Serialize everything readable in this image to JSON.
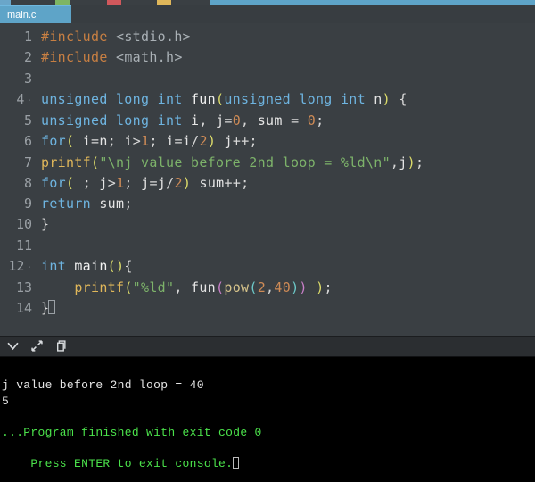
{
  "headerbar_colors": [
    "#6aa6c9",
    "#3a3f43",
    "#7eb563",
    "#3a3f43",
    "#d1585c",
    "#3a3f43",
    "#e0b75a",
    "#3a3f43",
    "#5ea4c8"
  ],
  "headerbar_widths": [
    12,
    50,
    16,
    42,
    16,
    40,
    16,
    44,
    364
  ],
  "tab": {
    "label": "main.c"
  },
  "code_lines": {
    "1": {
      "n": "1",
      "html": "<span class='tok-pp'>#include</span> <span class='tok-header'>&lt;stdio.h&gt;</span>"
    },
    "2": {
      "n": "2",
      "html": "<span class='tok-pp'>#include</span> <span class='tok-header'>&lt;math.h&gt;</span>"
    },
    "3": {
      "n": "3",
      "html": ""
    },
    "4": {
      "n": "4",
      "fold": true,
      "html": "<span class='tok-type'>unsigned long int</span> <span class='tok-func'>fun</span><span class='tok-paren-y'>(</span><span class='tok-type'>unsigned long int</span> <span class='tok-ident'>n</span><span class='tok-paren-y'>)</span> <span class='tok-brace'>{</span>"
    },
    "5": {
      "n": "5",
      "html": "<span class='tok-type'>unsigned long int</span> <span class='tok-ident'>i</span><span class='tok-punct'>,</span> <span class='tok-ident'>j</span><span class='tok-op'>=</span><span class='tok-num'>0</span><span class='tok-punct'>,</span> <span class='tok-ident'>sum</span> <span class='tok-op'>=</span> <span class='tok-num'>0</span><span class='tok-punct'>;</span>"
    },
    "6": {
      "n": "6",
      "html": "<span class='tok-kw'>for</span><span class='tok-paren-y'>(</span> <span class='tok-ident'>i</span><span class='tok-op'>=</span><span class='tok-ident'>n</span><span class='tok-punct'>;</span> <span class='tok-ident'>i</span><span class='tok-op'>&gt;</span><span class='tok-num'>1</span><span class='tok-punct'>;</span> <span class='tok-ident'>i</span><span class='tok-op'>=</span><span class='tok-ident'>i</span><span class='tok-op'>/</span><span class='tok-num'>2</span><span class='tok-paren-y'>)</span> <span class='tok-ident'>j</span><span class='tok-op'>++</span><span class='tok-punct'>;</span>"
    },
    "7": {
      "n": "7",
      "html": "<span class='tok-printf'>printf</span><span class='tok-paren-y'>(</span><span class='tok-str'>\"\\nj value before 2nd loop = %ld\\n\"</span><span class='tok-punct'>,</span><span class='tok-ident'>j</span><span class='tok-paren-y'>)</span><span class='tok-punct'>;</span>"
    },
    "8": {
      "n": "8",
      "html": "<span class='tok-kw'>for</span><span class='tok-paren-y'>(</span> <span class='tok-punct'>;</span> <span class='tok-ident'>j</span><span class='tok-op'>&gt;</span><span class='tok-num'>1</span><span class='tok-punct'>;</span> <span class='tok-ident'>j</span><span class='tok-op'>=</span><span class='tok-ident'>j</span><span class='tok-op'>/</span><span class='tok-num'>2</span><span class='tok-paren-y'>)</span> <span class='tok-ident'>sum</span><span class='tok-op'>++</span><span class='tok-punct'>;</span>"
    },
    "9": {
      "n": "9",
      "html": "<span class='tok-kw'>return</span> <span class='tok-ident'>sum</span><span class='tok-punct'>;</span>"
    },
    "10": {
      "n": "10",
      "html": "<span class='tok-brace'>}</span>"
    },
    "11": {
      "n": "11",
      "html": ""
    },
    "12": {
      "n": "12",
      "fold": true,
      "html": "<span class='tok-type'>int</span> <span class='tok-func'>main</span><span class='tok-paren-y'>()</span><span class='tok-brace'>{</span>"
    },
    "13": {
      "n": "13",
      "html": "    <span class='tok-printf'>printf</span><span class='tok-paren-y'>(</span><span class='tok-str'>\"%ld\"</span><span class='tok-punct'>,</span> <span class='tok-ident'>fun</span><span class='tok-paren-m'>(</span><span class='tok-call'>pow</span><span class='tok-paren-c'>(</span><span class='tok-num'>2</span><span class='tok-punct'>,</span><span class='tok-num'>40</span><span class='tok-paren-c'>)</span><span class='tok-paren-m'>)</span> <span class='tok-paren-y'>)</span><span class='tok-punct'>;</span>"
    },
    "14": {
      "n": "14",
      "html": "<span class='tok-brace'>}</span><span class='cursor-box'></span>"
    }
  },
  "terminal": {
    "line1": "j value before 2nd loop = 40",
    "line2": "5",
    "line3": "...Program finished with exit code 0",
    "line4": "Press ENTER to exit console."
  }
}
